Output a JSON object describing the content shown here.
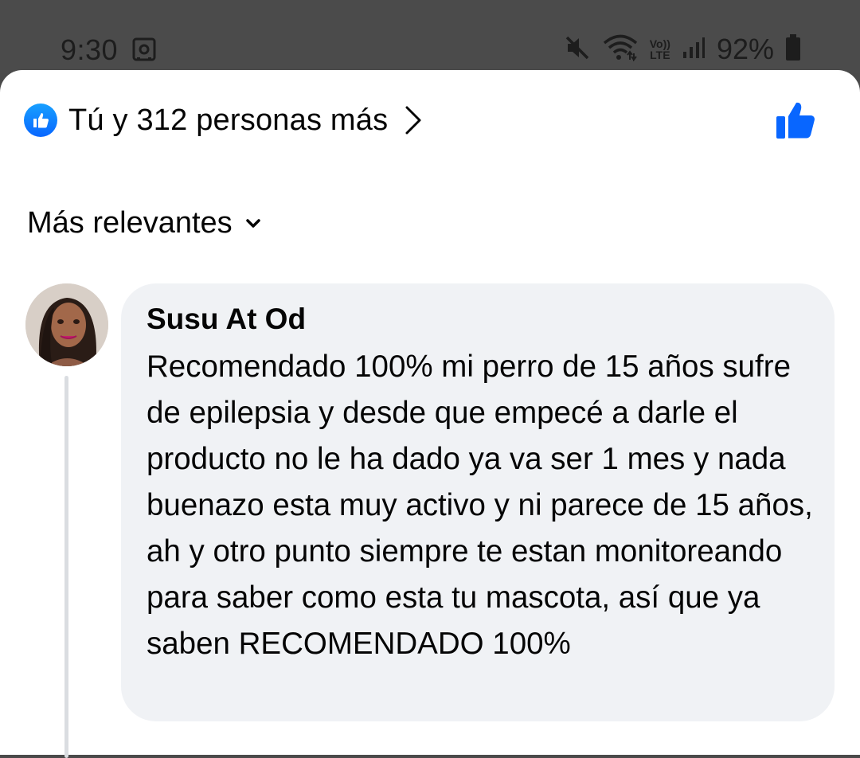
{
  "status_bar": {
    "time": "9:30",
    "left_icon": "safe-box-icon",
    "icons": [
      "mute-icon",
      "wifi-icon",
      "volte-icon",
      "signal-icon",
      "battery-icon"
    ],
    "volte_text_top": "Vo))",
    "volte_text_bottom": "LTE",
    "battery": "92%"
  },
  "reactions": {
    "icon": "like-icon",
    "summary": "Tú y 312 personas más",
    "like_button_icon": "thumbs-up-icon",
    "accent_color": "#0866ff"
  },
  "sort": {
    "label": "Más relevantes",
    "icon": "chevron-down-icon"
  },
  "comment": {
    "author": "Susu At Od",
    "text": "Recomendado 100% mi perro de 15 años sufre de epilepsia y desde que empecé a darle el producto no le ha dado ya va ser 1 mes y nada buenazo esta muy activo y ni parece de 15 años, ah y otro punto siempre te estan monitoreando para saber como esta tu mascota, así que ya saben RECOMENDADO 100%",
    "bubble_color": "#f0f2f5"
  }
}
